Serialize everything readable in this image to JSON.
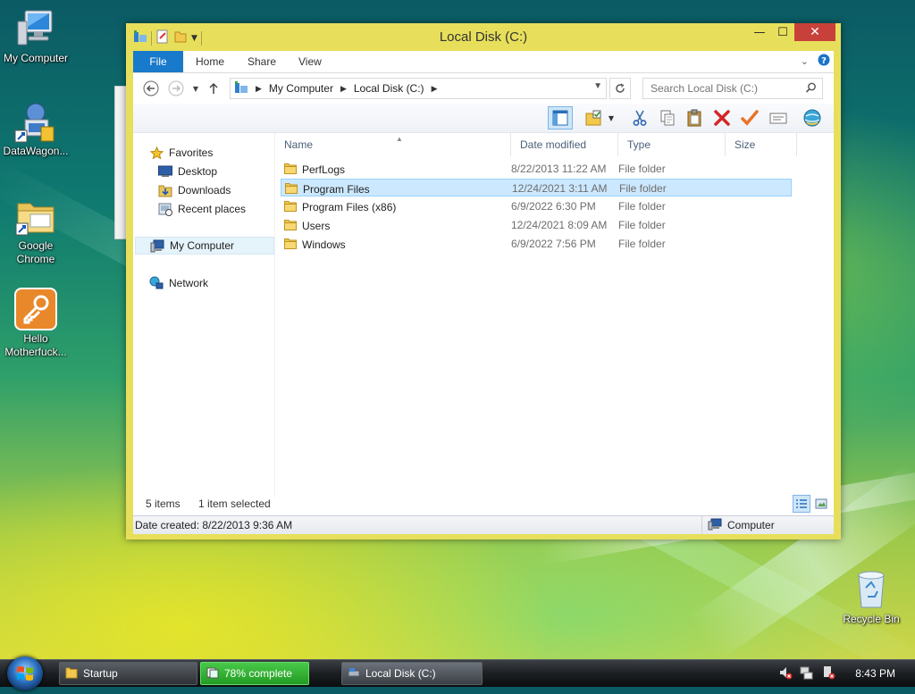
{
  "desktop": {
    "icons": [
      {
        "label_line1": "My Computer",
        "label_line2": ""
      },
      {
        "label_line1": "DataWagon...",
        "label_line2": ""
      },
      {
        "label_line1": "Google",
        "label_line2": "Chrome"
      },
      {
        "label_line1": "Hello",
        "label_line2": "Motherfuck..."
      },
      {
        "label_line1": "Recycle Bin",
        "label_line2": ""
      }
    ]
  },
  "window": {
    "title": "Local Disk (C:)",
    "controls": {
      "minimize": "—",
      "maximize": "☐",
      "close": "✕"
    },
    "ribbon": {
      "tabs": [
        "File",
        "Home",
        "Share",
        "View"
      ]
    },
    "address": {
      "segments": [
        "My Computer",
        "Local Disk (C:)"
      ],
      "search_placeholder": "Search Local Disk (C:)"
    },
    "nav_pane": {
      "favorites_label": "Favorites",
      "favorites": [
        "Desktop",
        "Downloads",
        "Recent places"
      ],
      "computer_label": "My Computer",
      "network_label": "Network"
    },
    "columns": [
      "Name",
      "Date modified",
      "Type",
      "Size"
    ],
    "files": [
      {
        "name": "PerfLogs",
        "date": "8/22/2013 11:22 AM",
        "type": "File folder",
        "selected": false
      },
      {
        "name": "Program Files",
        "date": "12/24/2021 3:11 AM",
        "type": "File folder",
        "selected": true
      },
      {
        "name": "Program Files (x86)",
        "date": "6/9/2022 6:30 PM",
        "type": "File folder",
        "selected": false
      },
      {
        "name": "Users",
        "date": "12/24/2021 8:09 AM",
        "type": "File folder",
        "selected": false
      },
      {
        "name": "Windows",
        "date": "6/9/2022 7:56 PM",
        "type": "File folder",
        "selected": false
      }
    ],
    "status": {
      "item_count": "5 items",
      "selection": "1 item selected",
      "date_created": "Date created: 8/22/2013 9:36 AM",
      "zone": "Computer"
    }
  },
  "taskbar": {
    "buttons": [
      {
        "label": "Startup"
      },
      {
        "label": "78% complete",
        "progress": 0.78
      },
      {
        "label": "Local Disk (C:)"
      }
    ],
    "clock": "8:43 PM"
  },
  "colors": {
    "accent": "#1979ca",
    "window_frame": "#e7df5b",
    "selection": "#cce8ff",
    "close": "#c7413a"
  }
}
